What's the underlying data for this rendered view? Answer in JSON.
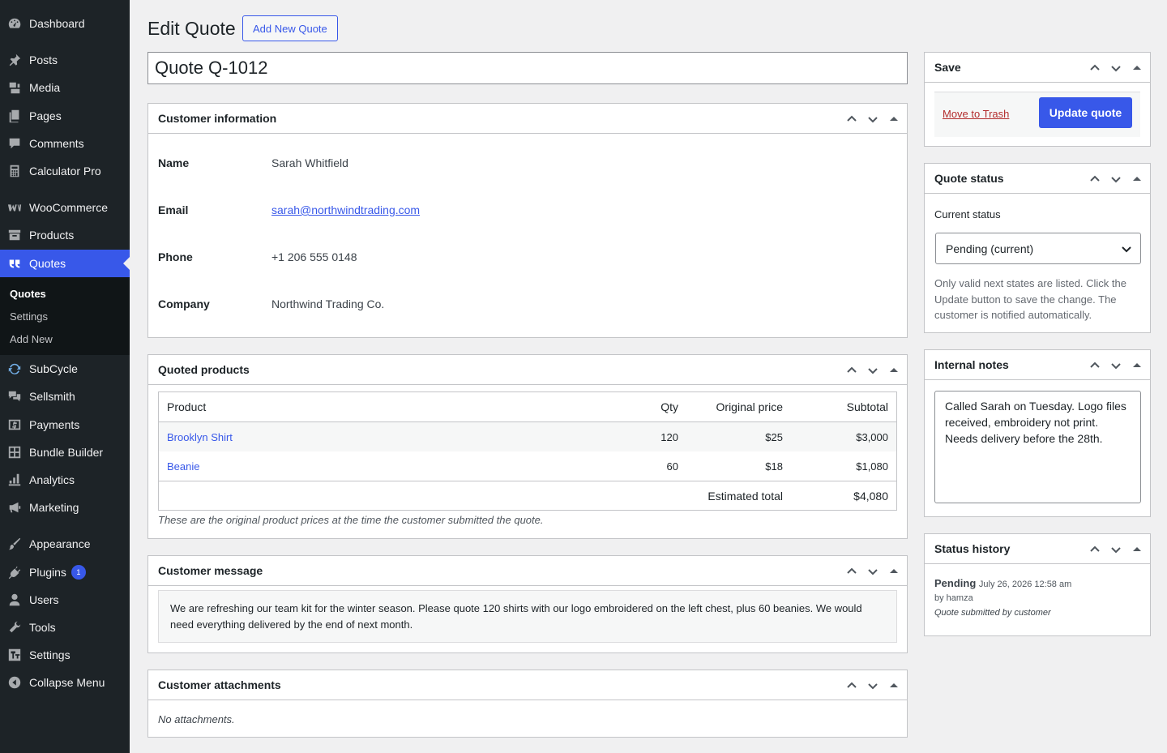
{
  "sidebar": {
    "items": [
      {
        "label": "Dashboard",
        "icon": "dashboard-icon"
      },
      {
        "label": "Posts",
        "icon": "pushpin-icon"
      },
      {
        "label": "Media",
        "icon": "media-icon"
      },
      {
        "label": "Pages",
        "icon": "pages-icon"
      },
      {
        "label": "Comments",
        "icon": "comments-icon"
      },
      {
        "label": "Calculator Pro",
        "icon": "calculator-icon"
      },
      {
        "label": "WooCommerce",
        "icon": "woocommerce-icon"
      },
      {
        "label": "Products",
        "icon": "archive-icon"
      },
      {
        "label": "Quotes",
        "icon": "quote-icon"
      },
      {
        "label": "SubCycle",
        "icon": "update-icon"
      },
      {
        "label": "Sellsmith",
        "icon": "chat-icon"
      },
      {
        "label": "Payments",
        "icon": "dollar-icon"
      },
      {
        "label": "Bundle Builder",
        "icon": "grid-icon"
      },
      {
        "label": "Analytics",
        "icon": "chart-bar-icon"
      },
      {
        "label": "Marketing",
        "icon": "megaphone-icon"
      },
      {
        "label": "Appearance",
        "icon": "brush-icon"
      },
      {
        "label": "Plugins",
        "icon": "plugin-icon",
        "badge": "1"
      },
      {
        "label": "Users",
        "icon": "user-icon"
      },
      {
        "label": "Tools",
        "icon": "wrench-icon"
      },
      {
        "label": "Settings",
        "icon": "settings-icon"
      },
      {
        "label": "Collapse Menu",
        "icon": "collapse-icon"
      }
    ],
    "submenu": [
      "Quotes",
      "Settings",
      "Add New"
    ]
  },
  "header": {
    "title": "Edit Quote",
    "add_new": "Add New Quote",
    "post_title": "Quote Q-1012"
  },
  "customer": {
    "heading": "Customer information",
    "rows": [
      {
        "label": "Name",
        "value": "Sarah Whitfield"
      },
      {
        "label": "Email",
        "value": "sarah@northwindtrading.com"
      },
      {
        "label": "Phone",
        "value": "+1 206 555 0148"
      },
      {
        "label": "Company",
        "value": "Northwind Trading Co."
      }
    ]
  },
  "products": {
    "heading": "Quoted products",
    "columns": [
      "Product",
      "Qty",
      "Original price",
      "Subtotal"
    ],
    "rows": [
      {
        "product": "Brooklyn Shirt",
        "qty": "120",
        "price": "$25",
        "subtotal": "$3,000"
      },
      {
        "product": "Beanie",
        "qty": "60",
        "price": "$18",
        "subtotal": "$1,080"
      }
    ],
    "total_label": "Estimated total",
    "total_value": "$4,080",
    "note": "These are the original product prices at the time the customer submitted the quote."
  },
  "message": {
    "heading": "Customer message",
    "text": "We are refreshing our team kit for the winter season. Please quote 120 shirts with our logo embroidered on the left chest, plus 60 beanies. We would need everything delivered by the end of next month."
  },
  "attachments": {
    "heading": "Customer attachments",
    "empty": "No attachments."
  },
  "save": {
    "heading": "Save",
    "trash": "Move to Trash",
    "update": "Update quote"
  },
  "status": {
    "heading": "Quote status",
    "label": "Current status",
    "selected": "Pending (current)",
    "help": "Only valid next states are listed. Click the Update button to save the change. The customer is notified automatically."
  },
  "notes": {
    "heading": "Internal notes",
    "text": "Called Sarah on Tuesday. Logo files received, embroidery not print. Needs delivery before the 28th."
  },
  "history": {
    "heading": "Status history",
    "status": "Pending",
    "date": "July 26, 2026 12:58 am",
    "by": "by hamza",
    "note": "Quote submitted by customer"
  },
  "colors": {
    "accent": "#3858e9",
    "sidebar_bg": "#1d2327",
    "trash": "#b32d2e"
  }
}
